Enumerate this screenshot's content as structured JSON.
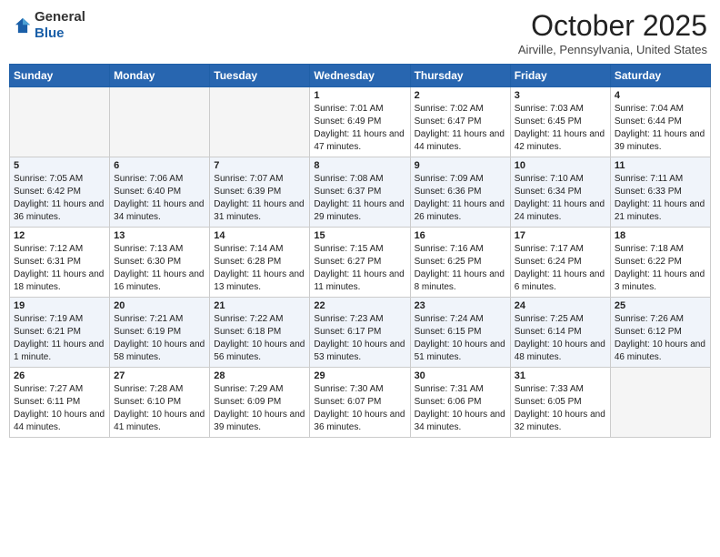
{
  "header": {
    "logo_general": "General",
    "logo_blue": "Blue",
    "month": "October 2025",
    "location": "Airville, Pennsylvania, United States"
  },
  "days_of_week": [
    "Sunday",
    "Monday",
    "Tuesday",
    "Wednesday",
    "Thursday",
    "Friday",
    "Saturday"
  ],
  "weeks": [
    [
      {
        "day": "",
        "sunrise": "",
        "sunset": "",
        "daylight": ""
      },
      {
        "day": "",
        "sunrise": "",
        "sunset": "",
        "daylight": ""
      },
      {
        "day": "",
        "sunrise": "",
        "sunset": "",
        "daylight": ""
      },
      {
        "day": "1",
        "sunrise": "7:01 AM",
        "sunset": "6:49 PM",
        "daylight": "11 hours and 47 minutes."
      },
      {
        "day": "2",
        "sunrise": "7:02 AM",
        "sunset": "6:47 PM",
        "daylight": "11 hours and 44 minutes."
      },
      {
        "day": "3",
        "sunrise": "7:03 AM",
        "sunset": "6:45 PM",
        "daylight": "11 hours and 42 minutes."
      },
      {
        "day": "4",
        "sunrise": "7:04 AM",
        "sunset": "6:44 PM",
        "daylight": "11 hours and 39 minutes."
      }
    ],
    [
      {
        "day": "5",
        "sunrise": "7:05 AM",
        "sunset": "6:42 PM",
        "daylight": "11 hours and 36 minutes."
      },
      {
        "day": "6",
        "sunrise": "7:06 AM",
        "sunset": "6:40 PM",
        "daylight": "11 hours and 34 minutes."
      },
      {
        "day": "7",
        "sunrise": "7:07 AM",
        "sunset": "6:39 PM",
        "daylight": "11 hours and 31 minutes."
      },
      {
        "day": "8",
        "sunrise": "7:08 AM",
        "sunset": "6:37 PM",
        "daylight": "11 hours and 29 minutes."
      },
      {
        "day": "9",
        "sunrise": "7:09 AM",
        "sunset": "6:36 PM",
        "daylight": "11 hours and 26 minutes."
      },
      {
        "day": "10",
        "sunrise": "7:10 AM",
        "sunset": "6:34 PM",
        "daylight": "11 hours and 24 minutes."
      },
      {
        "day": "11",
        "sunrise": "7:11 AM",
        "sunset": "6:33 PM",
        "daylight": "11 hours and 21 minutes."
      }
    ],
    [
      {
        "day": "12",
        "sunrise": "7:12 AM",
        "sunset": "6:31 PM",
        "daylight": "11 hours and 18 minutes."
      },
      {
        "day": "13",
        "sunrise": "7:13 AM",
        "sunset": "6:30 PM",
        "daylight": "11 hours and 16 minutes."
      },
      {
        "day": "14",
        "sunrise": "7:14 AM",
        "sunset": "6:28 PM",
        "daylight": "11 hours and 13 minutes."
      },
      {
        "day": "15",
        "sunrise": "7:15 AM",
        "sunset": "6:27 PM",
        "daylight": "11 hours and 11 minutes."
      },
      {
        "day": "16",
        "sunrise": "7:16 AM",
        "sunset": "6:25 PM",
        "daylight": "11 hours and 8 minutes."
      },
      {
        "day": "17",
        "sunrise": "7:17 AM",
        "sunset": "6:24 PM",
        "daylight": "11 hours and 6 minutes."
      },
      {
        "day": "18",
        "sunrise": "7:18 AM",
        "sunset": "6:22 PM",
        "daylight": "11 hours and 3 minutes."
      }
    ],
    [
      {
        "day": "19",
        "sunrise": "7:19 AM",
        "sunset": "6:21 PM",
        "daylight": "11 hours and 1 minute."
      },
      {
        "day": "20",
        "sunrise": "7:21 AM",
        "sunset": "6:19 PM",
        "daylight": "10 hours and 58 minutes."
      },
      {
        "day": "21",
        "sunrise": "7:22 AM",
        "sunset": "6:18 PM",
        "daylight": "10 hours and 56 minutes."
      },
      {
        "day": "22",
        "sunrise": "7:23 AM",
        "sunset": "6:17 PM",
        "daylight": "10 hours and 53 minutes."
      },
      {
        "day": "23",
        "sunrise": "7:24 AM",
        "sunset": "6:15 PM",
        "daylight": "10 hours and 51 minutes."
      },
      {
        "day": "24",
        "sunrise": "7:25 AM",
        "sunset": "6:14 PM",
        "daylight": "10 hours and 48 minutes."
      },
      {
        "day": "25",
        "sunrise": "7:26 AM",
        "sunset": "6:12 PM",
        "daylight": "10 hours and 46 minutes."
      }
    ],
    [
      {
        "day": "26",
        "sunrise": "7:27 AM",
        "sunset": "6:11 PM",
        "daylight": "10 hours and 44 minutes."
      },
      {
        "day": "27",
        "sunrise": "7:28 AM",
        "sunset": "6:10 PM",
        "daylight": "10 hours and 41 minutes."
      },
      {
        "day": "28",
        "sunrise": "7:29 AM",
        "sunset": "6:09 PM",
        "daylight": "10 hours and 39 minutes."
      },
      {
        "day": "29",
        "sunrise": "7:30 AM",
        "sunset": "6:07 PM",
        "daylight": "10 hours and 36 minutes."
      },
      {
        "day": "30",
        "sunrise": "7:31 AM",
        "sunset": "6:06 PM",
        "daylight": "10 hours and 34 minutes."
      },
      {
        "day": "31",
        "sunrise": "7:33 AM",
        "sunset": "6:05 PM",
        "daylight": "10 hours and 32 minutes."
      },
      {
        "day": "",
        "sunrise": "",
        "sunset": "",
        "daylight": ""
      }
    ]
  ],
  "labels": {
    "sunrise": "Sunrise:",
    "sunset": "Sunset:",
    "daylight": "Daylight:"
  }
}
